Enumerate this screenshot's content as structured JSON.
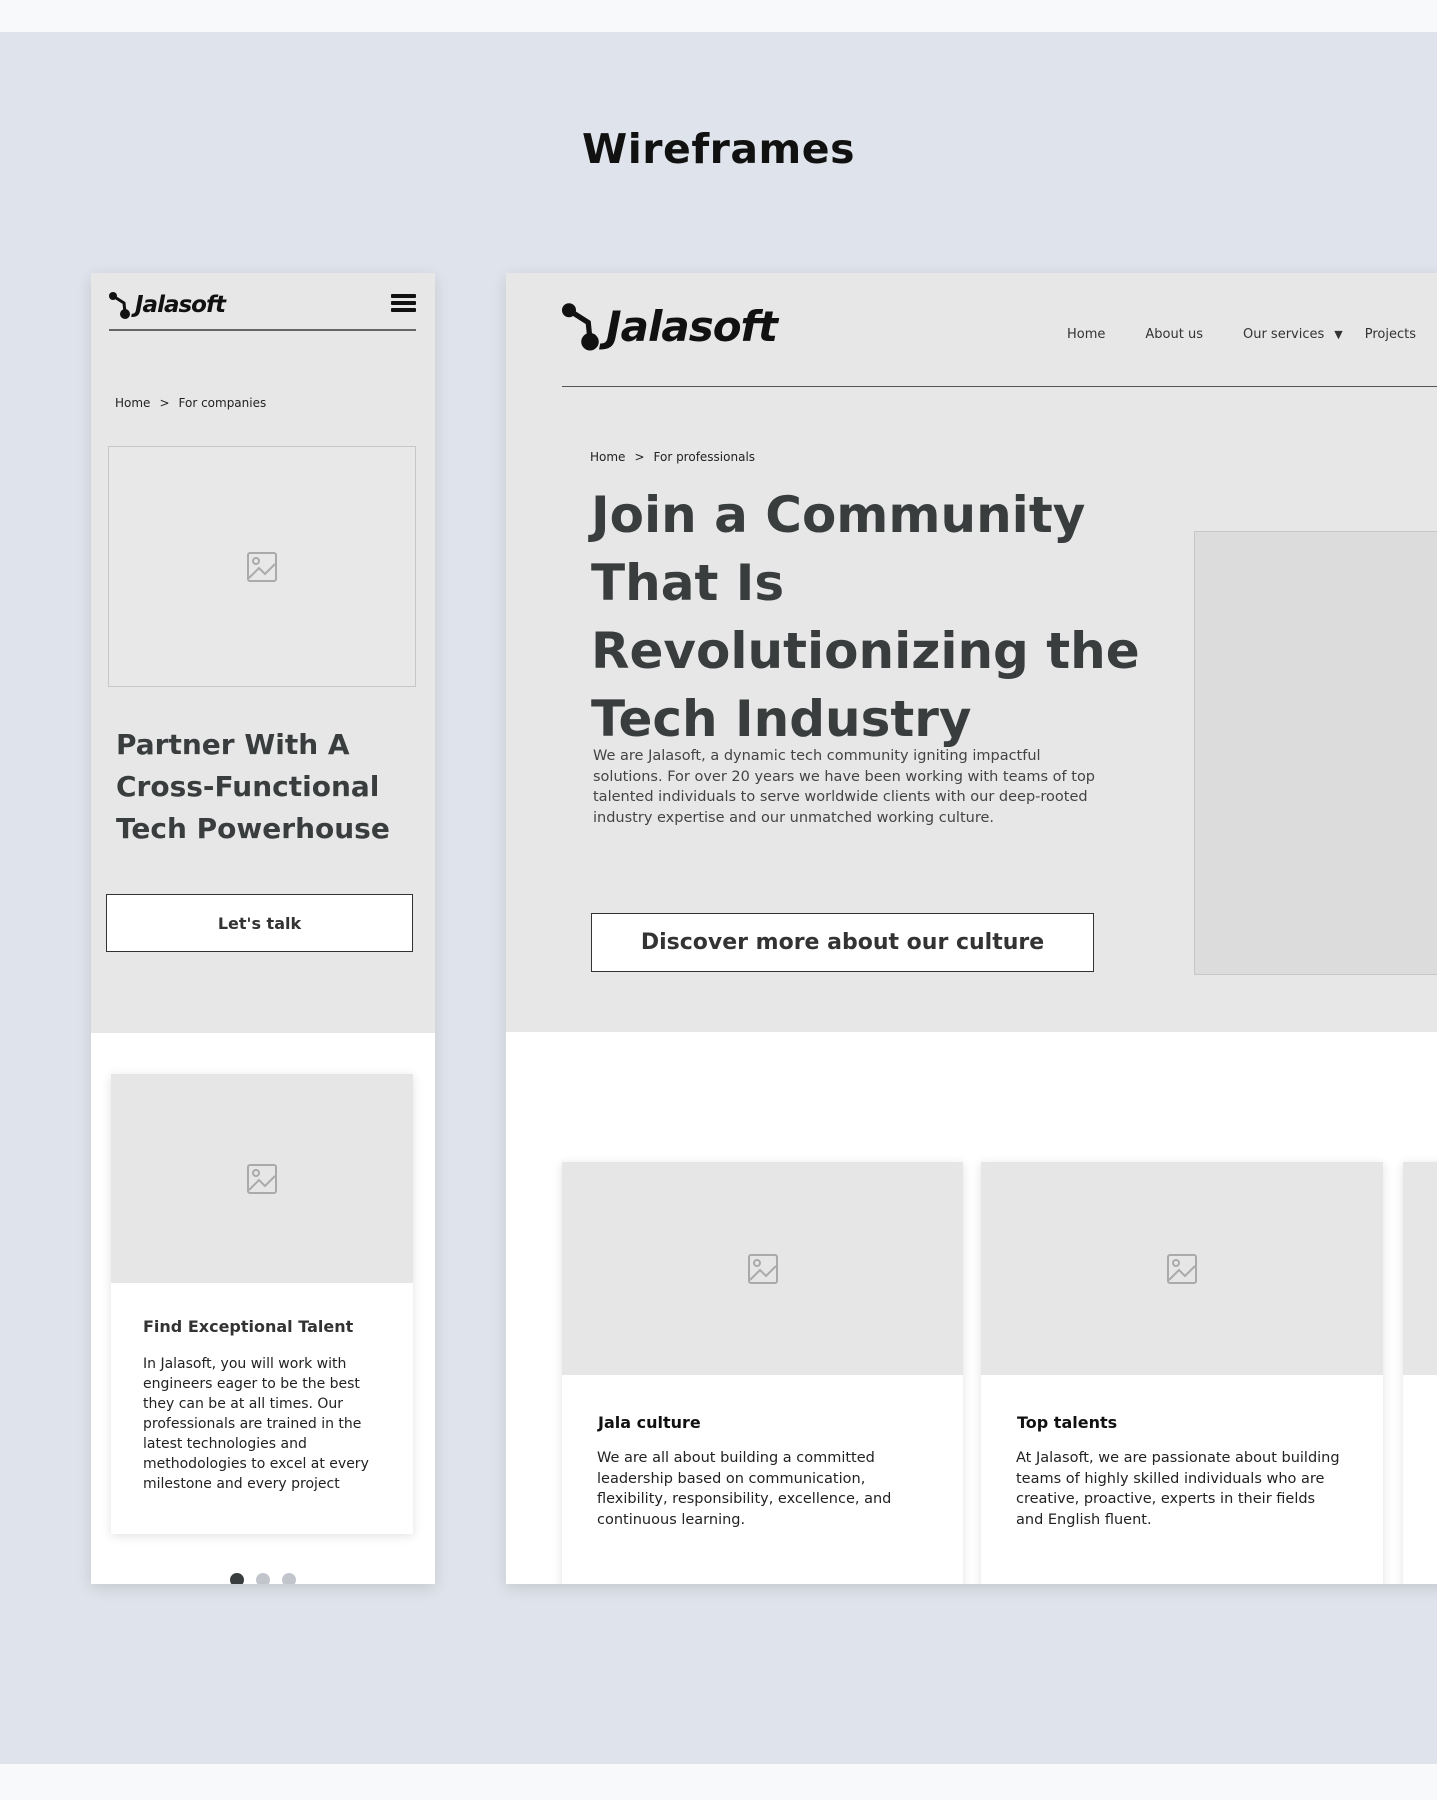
{
  "page": {
    "title": "Wireframes"
  },
  "mobile": {
    "logo": "Jalasoft",
    "breadcrumb": {
      "home": "Home",
      "separator": ">",
      "current": "For companies"
    },
    "hero": {
      "title": "Partner With A Cross-Functional Tech Powerhouse",
      "button": "Let's talk"
    },
    "card": {
      "title": "Find Exceptional Talent",
      "text": "In Jalasoft, you will work with engineers eager to be the best they can be at all times. Our professionals are trained in the latest technologies and methodologies to excel at every milestone and every project"
    },
    "carousel": {
      "count": 3,
      "active": 0
    }
  },
  "desktop": {
    "logo": "Jalasoft",
    "nav": {
      "home": "Home",
      "about": "About us",
      "services": "Our services",
      "projects": "Projects"
    },
    "breadcrumb": {
      "home": "Home",
      "separator": ">",
      "current": "For professionals"
    },
    "hero": {
      "title": "Join a Community That Is Revolutionizing the Tech Industry",
      "text": "We are Jalasoft, a dynamic tech community igniting impactful solutions. For over 20 years we have been working with teams of top talented individuals to serve worldwide clients with our deep-rooted industry expertise and our unmatched working culture.",
      "button": "Discover more about our culture"
    },
    "cards": [
      {
        "title": "Jala culture",
        "text": "We are all about building a committed leadership based on communication, flexibility, responsibility, excellence, and continuous learning."
      },
      {
        "title": "Top talents",
        "text": "At Jalasoft, we are passionate about building teams of highly skilled individuals who are creative, proactive, experts in their fields and English fluent."
      }
    ]
  },
  "colors": {
    "canvas": "#dfe3eb",
    "frame": "#e7e7e7",
    "heading": "#3a3d3e",
    "placeholder": "#e6e6e6"
  }
}
